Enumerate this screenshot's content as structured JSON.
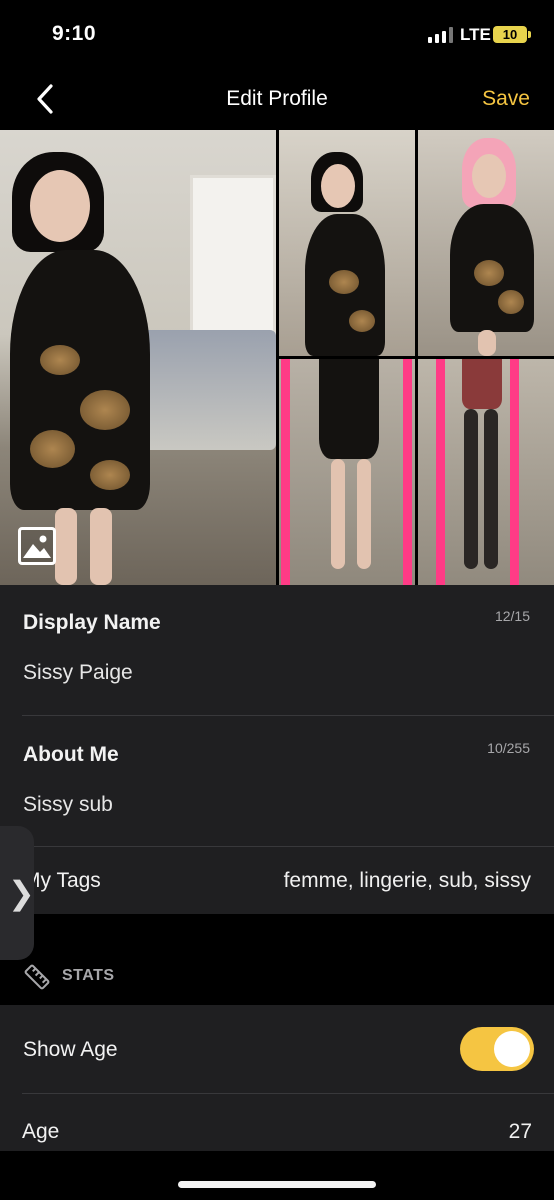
{
  "status_bar": {
    "time": "9:10",
    "network": "LTE",
    "battery": "10"
  },
  "nav": {
    "title": "Edit Profile",
    "save_label": "Save",
    "back_icon": "chevron-left-icon",
    "accent_color": "#f5c542"
  },
  "photos": {
    "count": 5,
    "gallery_icon": "image-gallery-icon"
  },
  "profile": {
    "display_name": {
      "label": "Display Name",
      "counter": "12/15",
      "value": "Sissy Paige"
    },
    "about_me": {
      "label": "About Me",
      "counter": "10/255",
      "value": "Sissy sub"
    },
    "tags": {
      "label": "My Tags",
      "value": "femme, lingerie, sub, sissy"
    }
  },
  "stats": {
    "section_label": "STATS",
    "section_icon": "ruler-icon",
    "show_age": {
      "label": "Show Age",
      "enabled": true
    },
    "age": {
      "label": "Age",
      "value": "27"
    }
  },
  "side_tab": {
    "icon": "chevron-right-icon"
  }
}
